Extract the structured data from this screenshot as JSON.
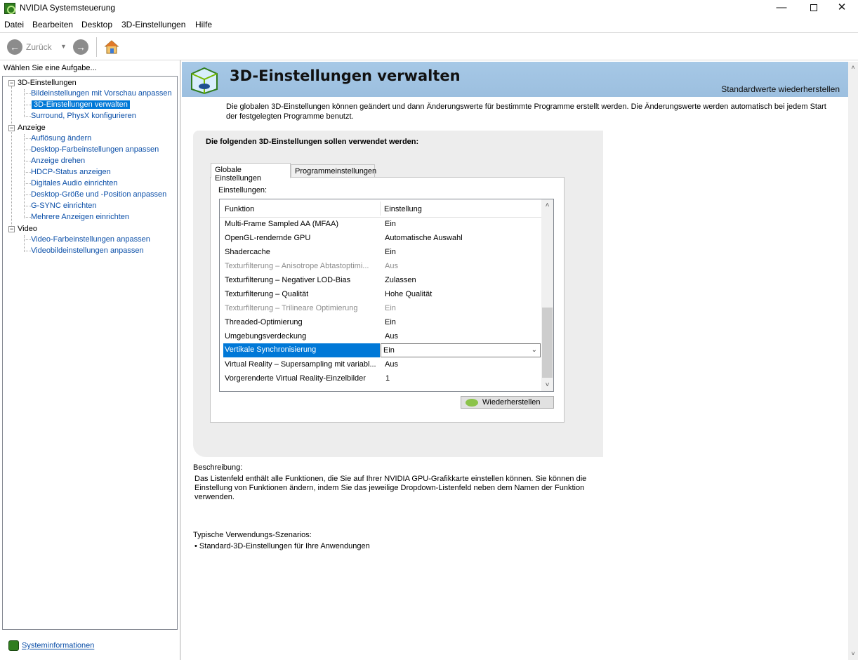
{
  "window": {
    "title": "NVIDIA Systemsteuerung"
  },
  "menu": [
    "Datei",
    "Bearbeiten",
    "Desktop",
    "3D-Einstellungen",
    "Hilfe"
  ],
  "toolbar": {
    "back_label": "Zurück"
  },
  "left": {
    "heading": "Wählen Sie eine Aufgabe...",
    "groups": [
      {
        "label": "3D-Einstellungen",
        "items": [
          "Bildeinstellungen mit Vorschau anpassen",
          "3D-Einstellungen verwalten",
          "Surround, PhysX konfigurieren"
        ]
      },
      {
        "label": "Anzeige",
        "items": [
          "Auflösung ändern",
          "Desktop-Farbeinstellungen anpassen",
          "Anzeige drehen",
          "HDCP-Status anzeigen",
          "Digitales Audio einrichten",
          "Desktop-Größe und -Position anpassen",
          "G-SYNC einrichten",
          "Mehrere Anzeigen einrichten"
        ]
      },
      {
        "label": "Video",
        "items": [
          "Video-Farbeinstellungen anpassen",
          "Videobildeinstellungen anpassen"
        ]
      }
    ],
    "selected_item": "3D-Einstellungen verwalten",
    "sysinfo_link": "Systeminformationen"
  },
  "banner": {
    "title": "3D-Einstellungen verwalten",
    "restore_defaults": "Standardwerte wiederherstellen"
  },
  "intro": "Die globalen 3D-Einstellungen können geändert und dann Änderungswerte für bestimmte Programme erstellt werden. Die Änderungswerte werden automatisch bei jedem Start der festgelegten Programme benutzt.",
  "group": {
    "heading": "Die folgenden 3D-Einstellungen sollen verwendet werden:",
    "tabs": [
      "Globale Einstellungen",
      "Programmeinstellungen"
    ],
    "settings_label": "Einstellungen:",
    "columns": [
      "Funktion",
      "Einstellung"
    ],
    "rows": [
      {
        "function": "Multi-Frame Sampled AA (MFAA)",
        "value": "Ein",
        "state": "normal"
      },
      {
        "function": "OpenGL-rendernde GPU",
        "value": "Automatische Auswahl",
        "state": "normal"
      },
      {
        "function": "Shadercache",
        "value": "Ein",
        "state": "normal"
      },
      {
        "function": "Texturfilterung – Anisotrope Abtastoptimi...",
        "value": "Aus",
        "state": "disabled"
      },
      {
        "function": "Texturfilterung – Negativer LOD-Bias",
        "value": "Zulassen",
        "state": "normal"
      },
      {
        "function": "Texturfilterung – Qualität",
        "value": "Hohe Qualität",
        "state": "normal"
      },
      {
        "function": "Texturfilterung – Trilineare Optimierung",
        "value": "Ein",
        "state": "disabled"
      },
      {
        "function": "Threaded-Optimierung",
        "value": "Ein",
        "state": "normal"
      },
      {
        "function": "Umgebungsverdeckung",
        "value": "Aus",
        "state": "normal"
      },
      {
        "function": "Vertikale Synchronisierung",
        "value": "Ein",
        "state": "selected"
      },
      {
        "function": "Virtual Reality – Supersampling mit variabl...",
        "value": "Aus",
        "state": "normal"
      },
      {
        "function": "Vorgerenderte Virtual Reality-Einzelbilder",
        "value": "1",
        "state": "normal"
      }
    ],
    "restore_button": "Wiederherstellen"
  },
  "description": {
    "heading": "Beschreibung:",
    "text": "Das Listenfeld enthält alle Funktionen, die Sie auf Ihrer NVIDIA GPU-Grafikkarte einstellen können. Sie können die Einstellung von Funktionen ändern, indem Sie das jeweilige Dropdown-Listenfeld neben dem Namen der Funktion verwenden."
  },
  "usage": {
    "heading": "Typische Verwendungs-Szenarios:",
    "items": [
      "Standard-3D-Einstellungen für Ihre Anwendungen"
    ]
  },
  "colors": {
    "banner": "#a6c8e6",
    "selection": "#0078d7",
    "link": "#0b4fa8",
    "nvidia_green": "#76b900"
  }
}
